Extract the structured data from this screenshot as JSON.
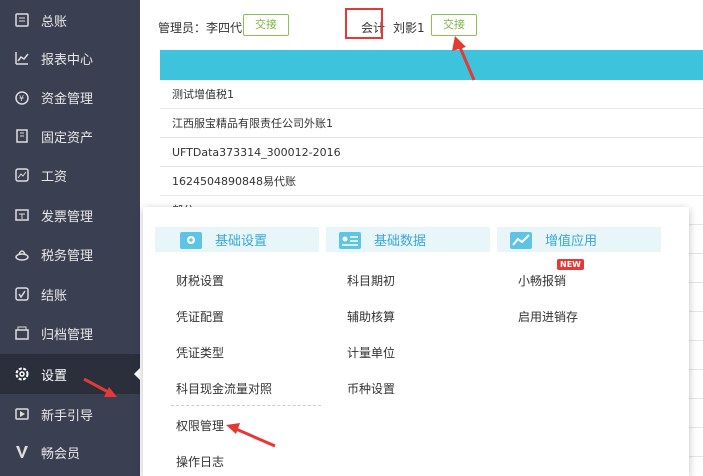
{
  "sidebar": {
    "items": [
      {
        "label": "总账",
        "icon": "ledger-icon"
      },
      {
        "label": "报表中心",
        "icon": "chart-icon"
      },
      {
        "label": "资金管理",
        "icon": "money-icon"
      },
      {
        "label": "固定资产",
        "icon": "building-icon"
      },
      {
        "label": "工资",
        "icon": "salary-icon"
      },
      {
        "label": "发票管理",
        "icon": "invoice-icon"
      },
      {
        "label": "税务管理",
        "icon": "tax-icon"
      },
      {
        "label": "结账",
        "icon": "checkout-icon"
      },
      {
        "label": "归档管理",
        "icon": "archive-icon"
      },
      {
        "label": "设置",
        "icon": "gear-icon"
      },
      {
        "label": "新手引导",
        "icon": "guide-icon"
      },
      {
        "label": "畅会员",
        "icon": "vip-icon"
      }
    ],
    "active_index": 9
  },
  "topbar": {
    "admin_label": "管理员：李四代",
    "handover_label": "交接",
    "accountant_label": "会计",
    "accountant_name": "刘影1",
    "handover2_label": "交接"
  },
  "table": {
    "rows": [
      "测试增值税1",
      "江西服宝精品有限责任公司外账1",
      "UFTData373314_300012-2016",
      "1624504890848易代账",
      "部分"
    ]
  },
  "dropdown": {
    "columns": [
      {
        "title": "基础设置",
        "icon": "basic-settings-icon",
        "items": [
          "财税设置",
          "凭证配置",
          "凭证类型",
          "科目现金流量对照",
          "权限管理",
          "操作日志"
        ]
      },
      {
        "title": "基础数据",
        "icon": "basic-data-icon",
        "items": [
          "科目期初",
          "辅助核算",
          "计量单位",
          "币种设置"
        ]
      },
      {
        "title": "增值应用",
        "icon": "value-app-icon",
        "items": [
          "小畅报销",
          "启用进销存"
        ]
      }
    ],
    "new_badge": "NEW"
  },
  "colors": {
    "sidebar_bg": "#3a3f51",
    "header_bar": "#3ec3dc",
    "accent_green": "#8cc152",
    "annotation_red": "#e53935",
    "menu_title": "#3aa8d8"
  }
}
